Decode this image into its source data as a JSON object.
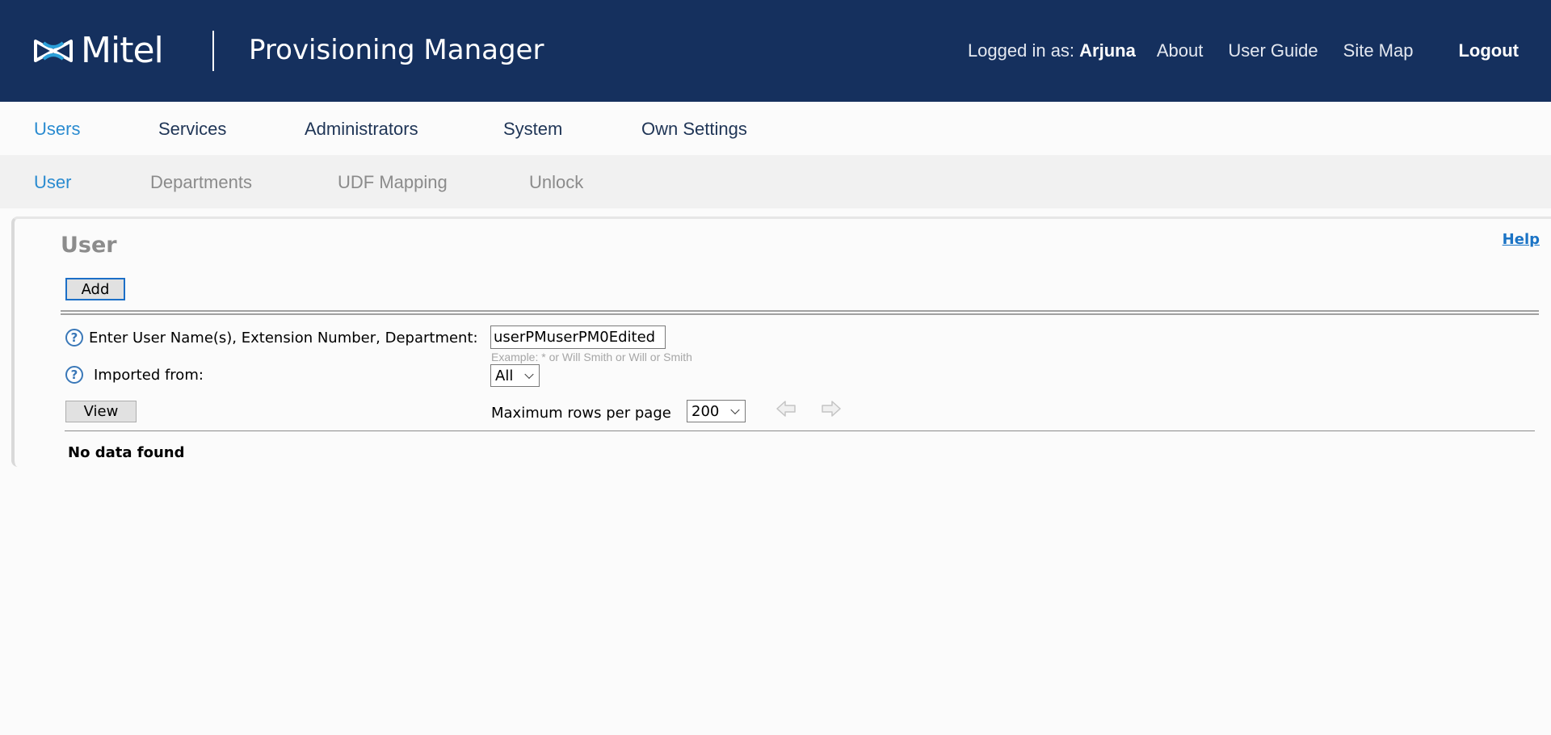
{
  "header": {
    "logo_text": "Mitel",
    "app_title": "Provisioning Manager",
    "logged_in_label": "Logged in as:",
    "logged_in_user": "Arjuna",
    "links": [
      "About",
      "User Guide",
      "Site Map"
    ],
    "logout_label": "Logout",
    "bg_color": "#15305e"
  },
  "main_nav": {
    "items": [
      "Users",
      "Services",
      "Administrators",
      "System",
      "Own Settings"
    ],
    "active": "Users",
    "active_color": "#2a8bd0"
  },
  "sub_nav": {
    "items": [
      "User",
      "Departments",
      "UDF Mapping",
      "Unlock"
    ],
    "active": "User"
  },
  "panel": {
    "title": "User",
    "help_label": "Help",
    "add_button": "Add",
    "search_label": "Enter User Name(s), Extension Number, Department:",
    "search_value": "userPMuserPM0Edited",
    "search_hint": "Example: * or Will Smith or Will or Smith",
    "imported_label": "Imported from:",
    "imported_value": "All",
    "view_button": "View",
    "rows_label": "Maximum rows per page",
    "rows_value": "200",
    "empty_message": "No data found",
    "help_icon_glyph": "?"
  }
}
